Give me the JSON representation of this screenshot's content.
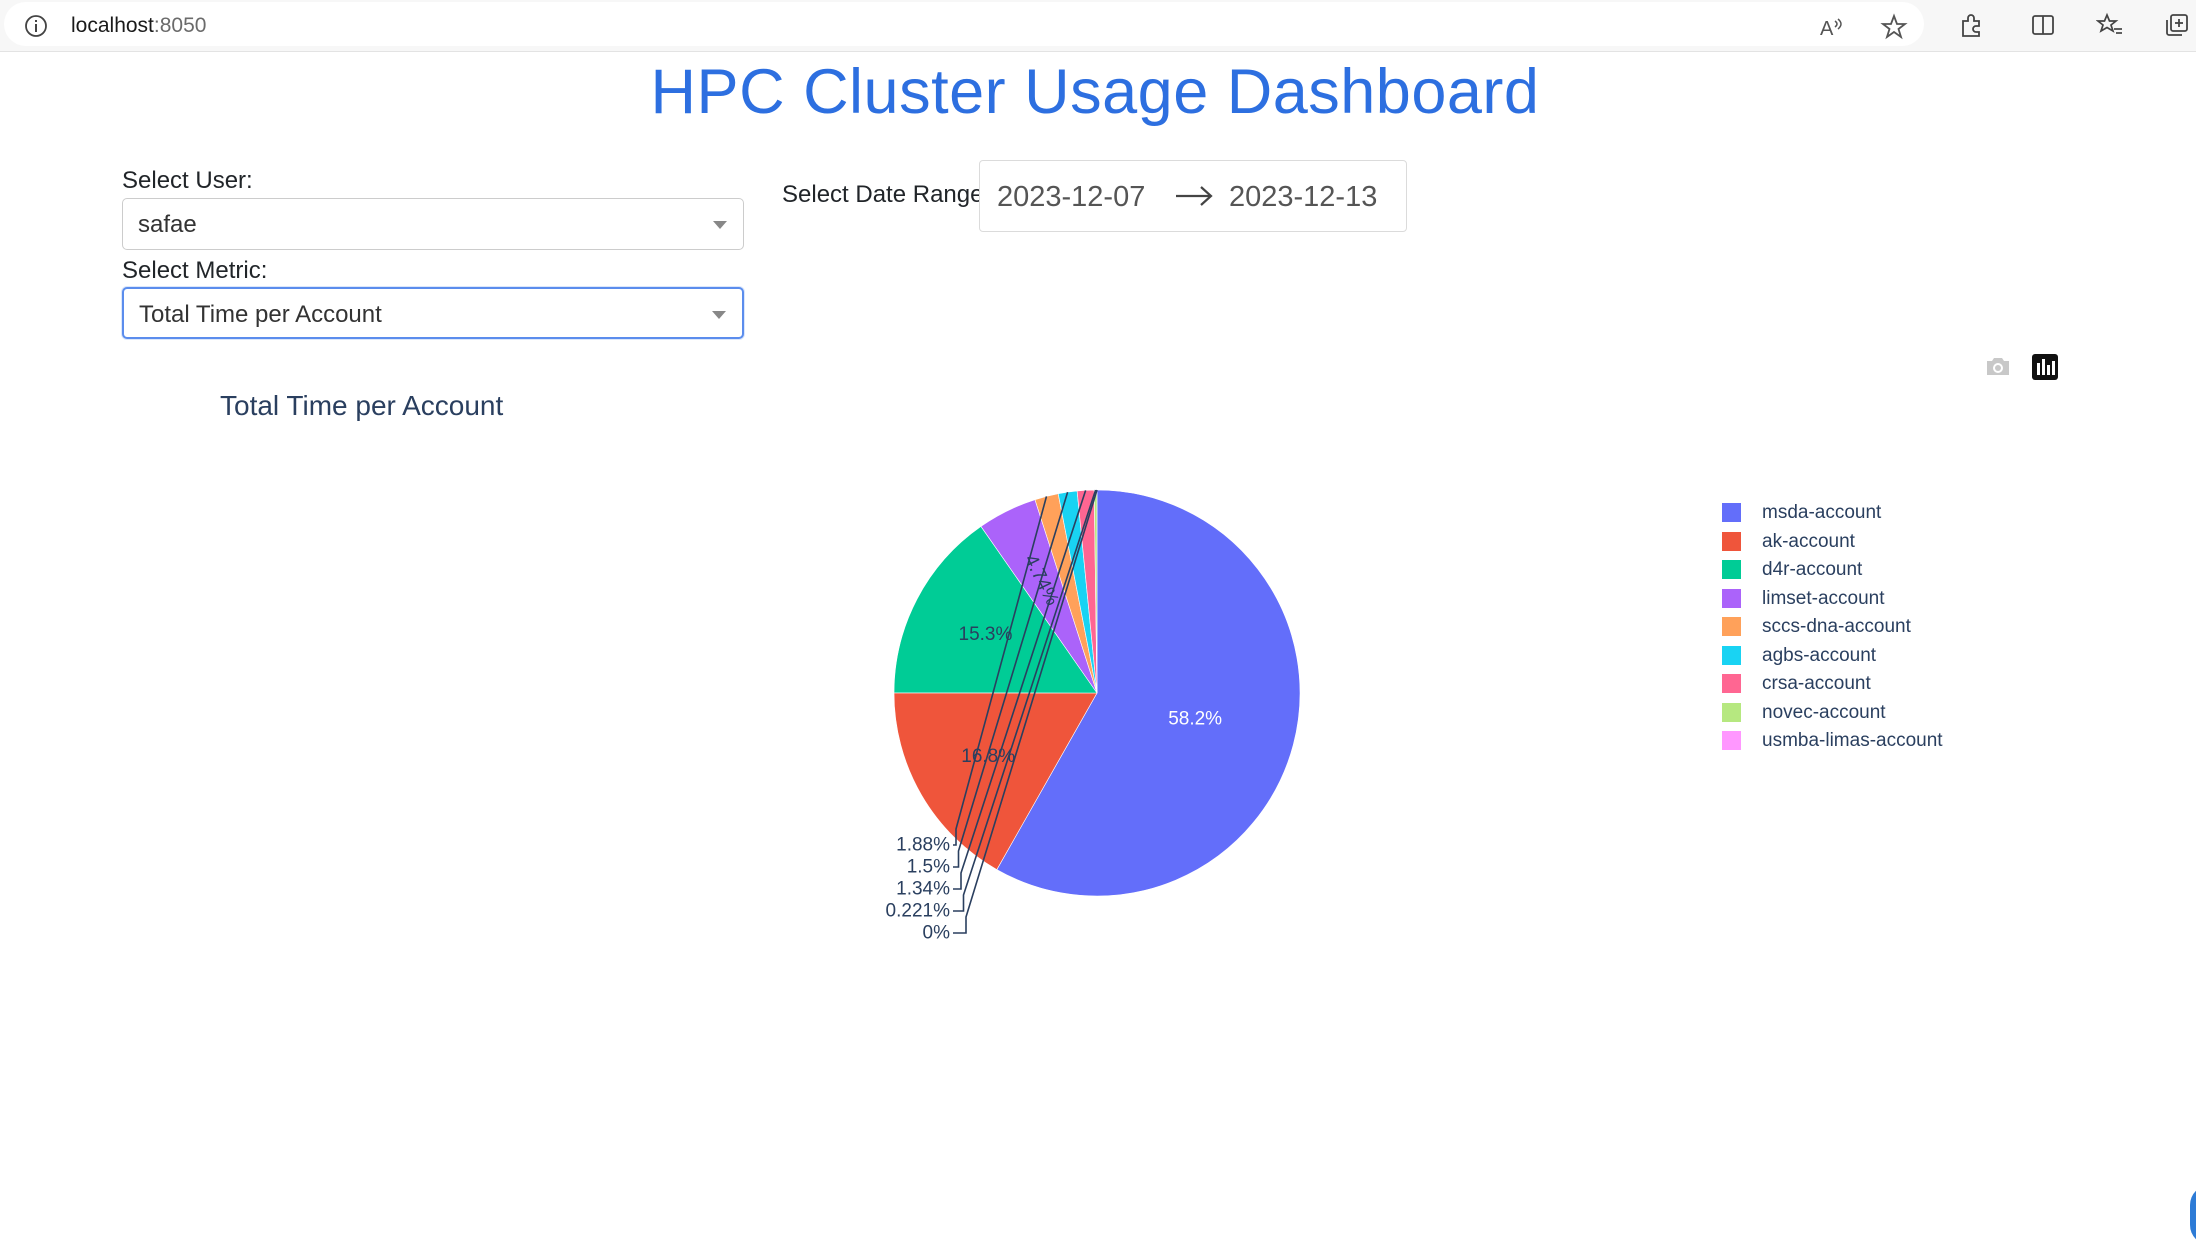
{
  "browser": {
    "url_host": "localhost",
    "url_port": ":8050"
  },
  "page": {
    "title": "HPC Cluster Usage Dashboard"
  },
  "controls": {
    "user_label": "Select User:",
    "user_value": "safae",
    "metric_label": "Select Metric:",
    "metric_value": "Total Time per Account",
    "date_label": "Select Date Range:",
    "date_start": "2023-12-07",
    "date_end": "2023-12-13"
  },
  "modebar": {
    "icons": [
      "camera-icon",
      "plotly-logo-icon"
    ]
  },
  "chart_data": {
    "type": "pie",
    "title": "Total Time per Account",
    "legend_position": "right",
    "slices": [
      {
        "label": "msda-account",
        "value": 58.2,
        "text": "58.2%",
        "color": "#636efa"
      },
      {
        "label": "ak-account",
        "value": 16.8,
        "text": "16.8%",
        "color": "#ef553b"
      },
      {
        "label": "d4r-account",
        "value": 15.3,
        "text": "15.3%",
        "color": "#00cc96"
      },
      {
        "label": "limset-account",
        "value": 4.74,
        "text": "4.74%",
        "color": "#ab63fa"
      },
      {
        "label": "sccs-dna-account",
        "value": 1.88,
        "text": "1.88%",
        "color": "#ffa15a"
      },
      {
        "label": "agbs-account",
        "value": 1.5,
        "text": "1.5%",
        "color": "#19d3f3"
      },
      {
        "label": "crsa-account",
        "value": 1.34,
        "text": "1.34%",
        "color": "#ff6692"
      },
      {
        "label": "novec-account",
        "value": 0.221,
        "text": "0.221%",
        "color": "#b6e880"
      },
      {
        "label": "usmba-limas-account",
        "value": 0,
        "text": "0%",
        "color": "#ff97ff"
      }
    ]
  }
}
